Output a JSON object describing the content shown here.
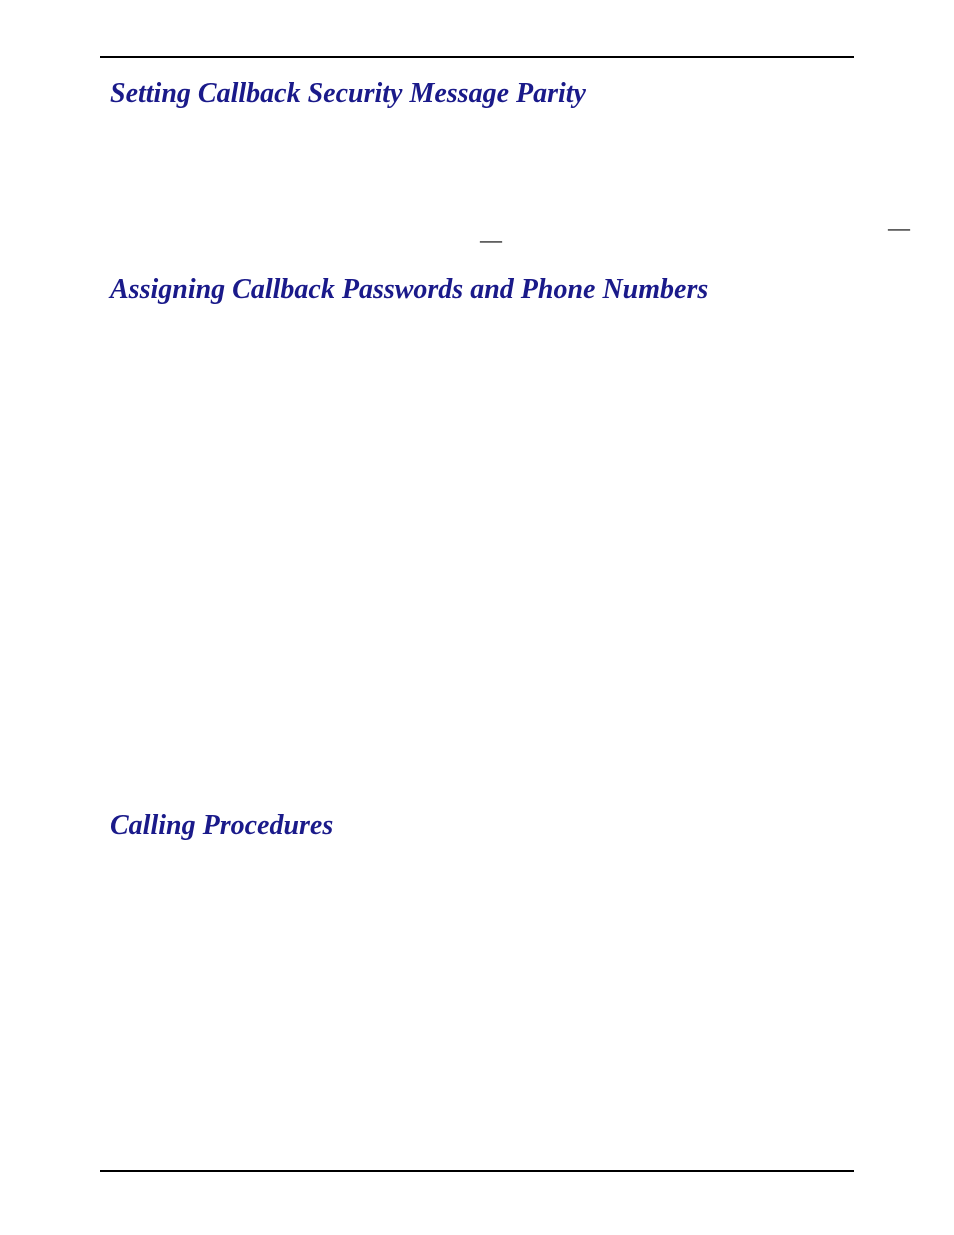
{
  "headings": {
    "h1": "Setting Callback Security Message Parity",
    "h2": "Assigning Callback Passwords and Phone Numbers",
    "h3": "Calling Procedures"
  },
  "marks": {
    "m1": "—",
    "m2": "—"
  }
}
